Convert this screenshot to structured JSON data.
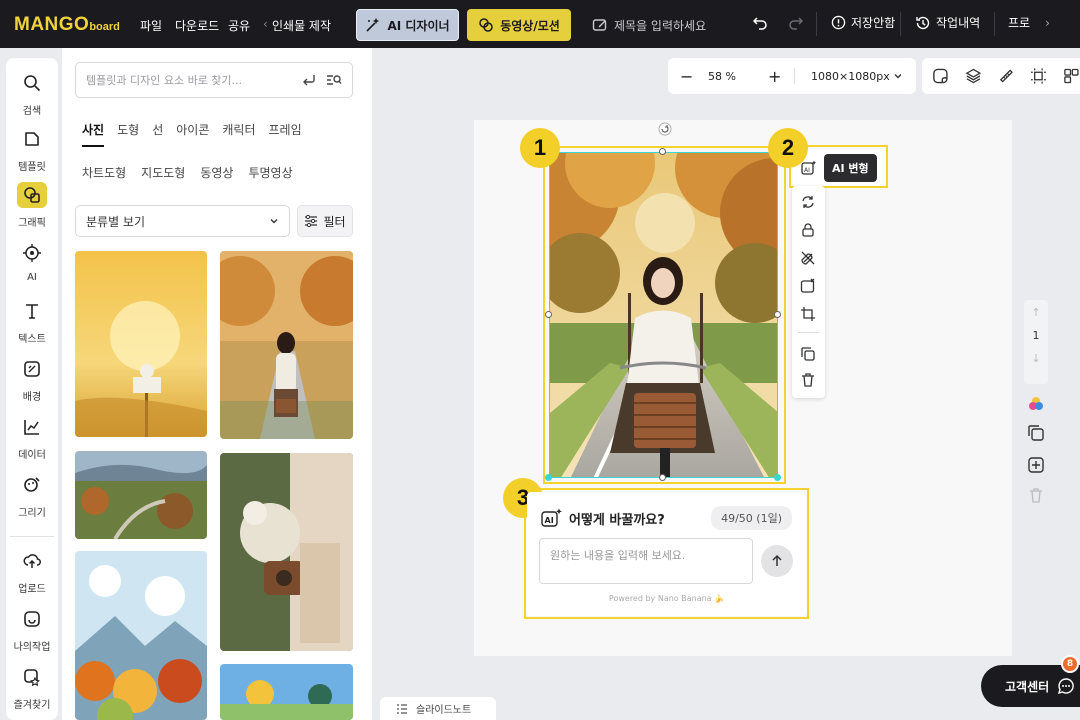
{
  "topbar": {
    "logo_main": "MANGO",
    "logo_sub": "board",
    "menu": [
      "파일",
      "다운로드",
      "공유",
      "인쇄물 제작"
    ],
    "ai_designer": "AI 디자이너",
    "video_motion": "동영상/모션",
    "title_placeholder": "제목을 입력하세요",
    "unsaved": "저장안함",
    "history": "작업내역",
    "profile": "프로"
  },
  "rail": {
    "items": [
      {
        "label": "검색",
        "icon": "search-icon"
      },
      {
        "label": "템플릿",
        "icon": "template-icon"
      },
      {
        "label": "그래픽",
        "icon": "graphic-icon",
        "active": true
      },
      {
        "label": "AI",
        "icon": "ai-chip-icon"
      },
      {
        "label": "텍스트",
        "icon": "text-icon"
      },
      {
        "label": "배경",
        "icon": "background-icon"
      },
      {
        "label": "데이터",
        "icon": "chart-icon"
      },
      {
        "label": "그리기",
        "icon": "draw-icon"
      },
      {
        "label": "업로드",
        "icon": "upload-icon"
      },
      {
        "label": "나의작업",
        "icon": "my-work-icon"
      },
      {
        "label": "즐겨찾기",
        "icon": "favorite-icon"
      }
    ]
  },
  "panel": {
    "search_placeholder": "템플릿과 디자인 요소 바로 찾기...",
    "tabs": [
      "사진",
      "도형",
      "선",
      "아이콘",
      "캐릭터",
      "프레임"
    ],
    "subtabs": [
      "차트도형",
      "지도도형",
      "동영상",
      "투명영상"
    ],
    "sort_label": "분류별 보기",
    "filter_label": "필터"
  },
  "canvas": {
    "zoom": "58 %",
    "size": "1080×1080px",
    "page_number": "1"
  },
  "ai_transform": {
    "badge1": "1",
    "badge2": "2",
    "badge3": "3",
    "tooltip": "AI 변형",
    "question": "어떻게 바꿀까요?",
    "count": "49/50 (1일)",
    "input_placeholder": "원하는 내용을 입력해 보세요.",
    "powered": "Powered by Nano Banana 🍌"
  },
  "footer": {
    "help": "고객센터",
    "help_badge": "8",
    "slide_notes": "슬라이드노트"
  }
}
